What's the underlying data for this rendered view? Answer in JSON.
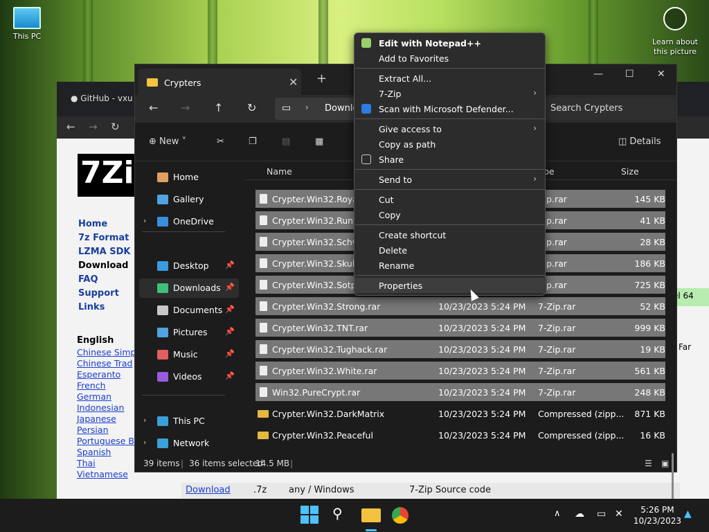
{
  "desktop": {
    "this_pc": "This PC",
    "learn_about": "Learn about this picture"
  },
  "browser": {
    "tab_title": "GitHub - vxu",
    "menu": [
      "Home",
      "7z Format",
      "LZMA SDK",
      "Download",
      "FAQ",
      "Support",
      "Links"
    ],
    "lang_heading": "English",
    "languages": [
      "Chinese Simp",
      "Chinese Trad",
      "Esperanto",
      "French",
      "German",
      "Indonesian",
      "Japanese",
      "Persian",
      "Portuguese B",
      "Spanish",
      "Thai",
      "Vietnamese"
    ],
    "frag_el64": "el 64",
    "frag_far": "Far",
    "download_row": {
      "link": "Download",
      "ext": ".7z",
      "platform": "any / Windows",
      "desc": "7-Zip Source code"
    }
  },
  "explorer": {
    "tab_title": "Crypters",
    "address": "Downlo",
    "search_placeholder": "Search Crypters",
    "cmd": {
      "new": "New",
      "details": "Details"
    },
    "sidebar": [
      {
        "label": "Home",
        "color": "#e0a060"
      },
      {
        "label": "Gallery",
        "color": "#4fa3e0"
      },
      {
        "label": "OneDrive",
        "color": "#3b8de0"
      },
      {
        "label": "Desktop",
        "color": "#3b9be0"
      },
      {
        "label": "Downloads",
        "color": "#3ec07a"
      },
      {
        "label": "Documents",
        "color": "#c9c9c9"
      },
      {
        "label": "Pictures",
        "color": "#4fa3e0"
      },
      {
        "label": "Music",
        "color": "#e06060"
      },
      {
        "label": "Videos",
        "color": "#9a5ae0"
      },
      {
        "label": "This PC",
        "color": "#3ba0d8"
      },
      {
        "label": "Network",
        "color": "#3ba0d8"
      }
    ],
    "columns": {
      "name": "Name",
      "type": "pe",
      "size": "Size"
    },
    "files": [
      {
        "name": "Crypter.Win32.Royal.rar",
        "date": "",
        "type": "Zip.rar",
        "size": "145 KB",
        "selected": true
      },
      {
        "name": "Crypter.Win32.Runtim",
        "date": "",
        "type": "Zip.rar",
        "size": "41 KB",
        "selected": true
      },
      {
        "name": "Crypter.Win32.Schwarz",
        "date": "",
        "type": "Zip.rar",
        "size": "28 KB",
        "selected": true
      },
      {
        "name": "Crypter.Win32.SkullByt",
        "date": "",
        "type": "Zip.rar",
        "size": "186 KB",
        "selected": true
      },
      {
        "name": "Crypter.Win32.Sotpot.r",
        "date": "",
        "type": "Zip.rar",
        "size": "725 KB",
        "selected": true
      },
      {
        "name": "Crypter.Win32.Strong.rar",
        "date": "10/23/2023 5:24 PM",
        "type": "7-Zip.rar",
        "size": "52 KB",
        "selected": true
      },
      {
        "name": "Crypter.Win32.TNT.rar",
        "date": "10/23/2023 5:24 PM",
        "type": "7-Zip.rar",
        "size": "999 KB",
        "selected": true
      },
      {
        "name": "Crypter.Win32.Tughack.rar",
        "date": "10/23/2023 5:24 PM",
        "type": "7-Zip.rar",
        "size": "19 KB",
        "selected": true
      },
      {
        "name": "Crypter.Win32.White.rar",
        "date": "10/23/2023 5:24 PM",
        "type": "7-Zip.rar",
        "size": "561 KB",
        "selected": true
      },
      {
        "name": "Win32.PureCrypt.rar",
        "date": "10/23/2023 5:24 PM",
        "type": "7-Zip.rar",
        "size": "248 KB",
        "selected": true
      },
      {
        "name": "Crypter.Win32.DarkMatrix",
        "date": "10/23/2023 5:24 PM",
        "type": "Compressed (zipp...",
        "size": "871 KB",
        "selected": false
      },
      {
        "name": "Crypter.Win32.Peaceful",
        "date": "10/23/2023 5:24 PM",
        "type": "Compressed (zipp...",
        "size": "16 KB",
        "selected": false
      }
    ],
    "status": {
      "items": "39 items",
      "selected": "36 items selected",
      "size": "14.5 MB"
    }
  },
  "context_menu": [
    {
      "label": "Edit with Notepad++",
      "bold": true,
      "icon": "notepad-icon",
      "arrow": false
    },
    {
      "label": "Add to Favorites",
      "bold": false,
      "icon": "",
      "arrow": false
    },
    {
      "label": "Extract All...",
      "bold": false,
      "icon": "",
      "arrow": false
    },
    {
      "label": "7-Zip",
      "bold": false,
      "icon": "",
      "arrow": true
    },
    {
      "label": "Scan with Microsoft Defender...",
      "bold": false,
      "icon": "defender-shield-icon",
      "arrow": false
    },
    {
      "label": "Give access to",
      "bold": false,
      "icon": "",
      "arrow": true
    },
    {
      "label": "Copy as path",
      "bold": false,
      "icon": "",
      "arrow": false
    },
    {
      "label": "Share",
      "bold": false,
      "icon": "share-icon",
      "arrow": false
    },
    {
      "label": "Send to",
      "bold": false,
      "icon": "",
      "arrow": true
    },
    {
      "label": "Cut",
      "bold": false,
      "icon": "",
      "arrow": false
    },
    {
      "label": "Copy",
      "bold": false,
      "icon": "",
      "arrow": false
    },
    {
      "label": "Create shortcut",
      "bold": false,
      "icon": "",
      "arrow": false
    },
    {
      "label": "Delete",
      "bold": false,
      "icon": "",
      "arrow": false
    },
    {
      "label": "Rename",
      "bold": false,
      "icon": "",
      "arrow": false
    },
    {
      "label": "Properties",
      "bold": false,
      "icon": "",
      "arrow": false
    }
  ],
  "taskbar": {
    "time": "5:26 PM",
    "date": "10/23/2023"
  }
}
